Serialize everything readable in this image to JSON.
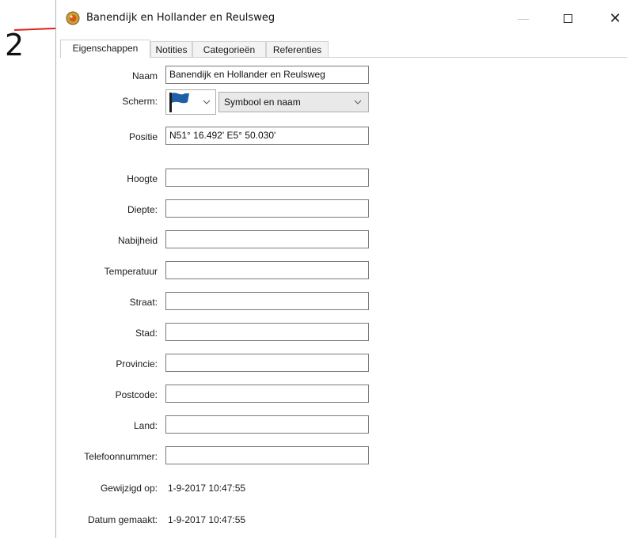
{
  "annotation": {
    "number": "2"
  },
  "window": {
    "title": "Banendijk en Hollander en Reulsweg",
    "min_glyph": "—",
    "close_glyph": "✕"
  },
  "tabs": [
    {
      "label": "Eigenschappen",
      "active": true
    },
    {
      "label": "Notities",
      "active": false
    },
    {
      "label": "Categorieën",
      "active": false
    },
    {
      "label": "Referenties",
      "active": false
    }
  ],
  "form": {
    "naam": {
      "label": "Naam",
      "value": "Banendijk en Hollander en Reulsweg"
    },
    "scherm": {
      "label": "Scherm:",
      "icon": "blue-flag-icon",
      "value": "Symbool en naam"
    },
    "positie": {
      "label": "Positie",
      "value": "N51° 16.492' E5° 50.030'"
    },
    "hoogte": {
      "label": "Hoogte",
      "value": ""
    },
    "diepte": {
      "label": "Diepte:",
      "value": ""
    },
    "nabijheid": {
      "label": "Nabijheid",
      "value": ""
    },
    "temperatuur": {
      "label": "Temperatuur",
      "value": ""
    },
    "straat": {
      "label": "Straat:",
      "value": ""
    },
    "stad": {
      "label": "Stad:",
      "value": ""
    },
    "provincie": {
      "label": "Provincie:",
      "value": ""
    },
    "postcode": {
      "label": "Postcode:",
      "value": ""
    },
    "land": {
      "label": "Land:",
      "value": ""
    },
    "telefoon": {
      "label": "Telefoonnummer:",
      "value": ""
    },
    "gewijzigd": {
      "label": "Gewijzigd op:",
      "value": "1-9-2017 10:47:55"
    },
    "gemaakt": {
      "label": "Datum gemaakt:",
      "value": "1-9-2017 10:47:55"
    }
  },
  "colors": {
    "annotation_arrow": "#e02020",
    "flag": "#1f5fa8"
  }
}
